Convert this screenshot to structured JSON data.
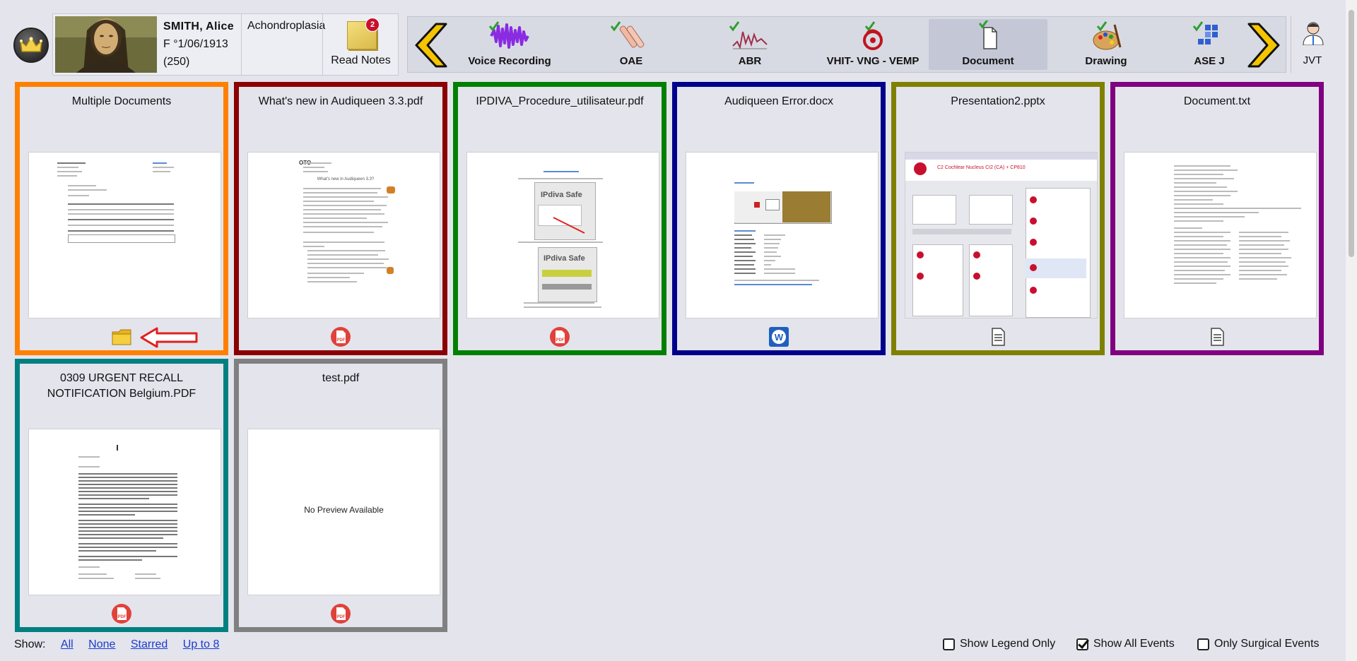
{
  "patient": {
    "name": "SMITH, Alice",
    "sex_dob": "F °1/06/1913",
    "id": "(250)",
    "diagnosis": "Achondroplasia"
  },
  "notes": {
    "label": "Read Notes",
    "badge": "2"
  },
  "nav": {
    "items": [
      {
        "label": "Voice Recording",
        "icon": "voice-waveform-icon",
        "checked": true
      },
      {
        "label": "OAE",
        "icon": "oae-probe-icon",
        "checked": true
      },
      {
        "label": "ABR",
        "icon": "abr-wave-icon",
        "checked": true
      },
      {
        "label": "VHIT- VNG - VEMP",
        "icon": "vestibular-icon",
        "checked": true
      },
      {
        "label": "Document",
        "icon": "document-icon",
        "checked": true,
        "active": true
      },
      {
        "label": "Drawing",
        "icon": "palette-icon",
        "checked": true
      },
      {
        "label": "ASE J",
        "icon": "grid-icon",
        "checked": true
      }
    ]
  },
  "user": {
    "label": "JVT"
  },
  "cards": [
    {
      "title": "Multiple Documents",
      "border": "#ff8000",
      "icon": "folder-icon"
    },
    {
      "title": "What's new in Audiqueen 3.3.pdf",
      "border": "#8b0000",
      "icon": "pdf-icon"
    },
    {
      "title": "IPDIVA_Procedure_utilisateur.pdf",
      "border": "#008000",
      "icon": "pdf-icon"
    },
    {
      "title": "Audiqueen Error.docx",
      "border": "#00008b",
      "icon": "word-icon"
    },
    {
      "title": "Presentation2.pptx",
      "border": "#808000",
      "icon": "text-file-icon"
    },
    {
      "title": "Document.txt",
      "border": "#800080",
      "icon": "text-file-icon"
    },
    {
      "title": "0309 URGENT RECALL NOTIFICATION Belgium.PDF",
      "border": "#008080",
      "icon": "pdf-icon"
    },
    {
      "title": "test.pdf",
      "border": "#808080",
      "icon": "pdf-icon",
      "preview_text": "No Preview Available"
    }
  ],
  "thumb_text": {
    "oto": "OTO",
    "audiqueen_title": "What's new in Audiqueen 3.3?",
    "ipdiva_logo": "IPdiva Safe",
    "pptx_header": "C2 Cochlear Nucleus CI2 (CA) + CP810"
  },
  "footer": {
    "show_label": "Show:",
    "links": [
      "All",
      "None",
      "Starred",
      "Up to 8"
    ]
  },
  "options": [
    {
      "label": "Show Legend Only",
      "checked": false
    },
    {
      "label": "Show All Events",
      "checked": true
    },
    {
      "label": "Only Surgical Events",
      "checked": false
    }
  ]
}
